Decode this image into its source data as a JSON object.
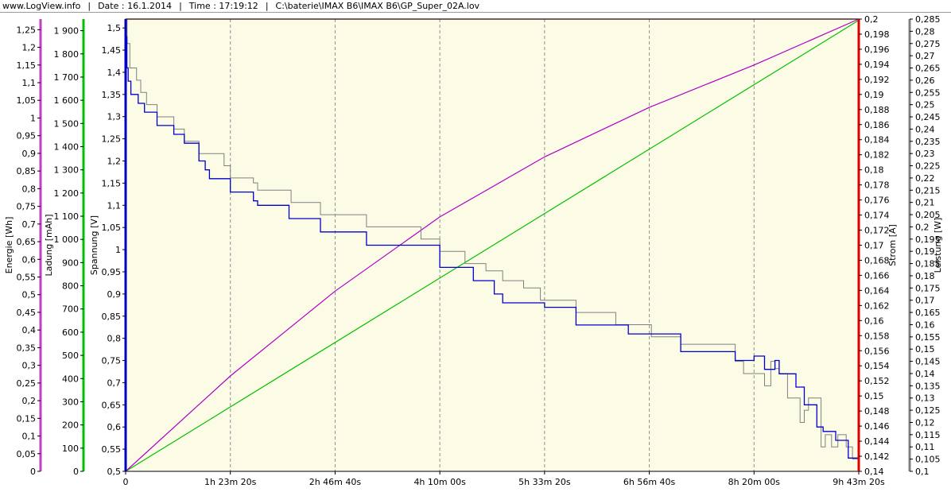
{
  "header": {
    "brand": "www.LogView.info",
    "date": "Date : 16.1.2014",
    "time": "Time : 17:19:12",
    "file": "C:\\baterie\\IMAX B6\\IMAX B6\\GP_Super_02A.lov"
  },
  "chart_data": {
    "type": "line",
    "background": "#fcfce6",
    "plot_border_color": "#000000",
    "vertical_grid": "dashed",
    "x": {
      "label": "",
      "range_s": [
        0,
        35000
      ],
      "ticks_s": [
        0,
        5000,
        10000,
        15000,
        20000,
        25000,
        30000,
        35000
      ],
      "tick_labels": [
        "0",
        "1h 23m 20s",
        "2h 46m 40s",
        "4h 10m 00s",
        "5h 33m 20s",
        "6h 56m 40s",
        "8h 20m 00s",
        "9h 43m 20s"
      ]
    },
    "axes": {
      "energie": {
        "label": "Energie [Wh]",
        "color": "#c040c0",
        "range": [
          0,
          1.28
        ],
        "ticks": [
          "0",
          "0,05",
          "0,1",
          "0,15",
          "0,2",
          "0,25",
          "0,3",
          "0,35",
          "0,4",
          "0,45",
          "0,5",
          "0,55",
          "0,6",
          "0,65",
          "0,7",
          "0,75",
          "0,8",
          "0,85",
          "0,9",
          "0,95",
          "1",
          "1,05",
          "1,1",
          "1,15",
          "1,2",
          "1,25"
        ]
      },
      "ladung": {
        "label": "Ladung [mAh]",
        "color": "#00c000",
        "range": [
          0,
          1950
        ],
        "ticks": [
          "0",
          "100",
          "200",
          "300",
          "400",
          "500",
          "600",
          "700",
          "800",
          "900",
          "1 000",
          "1 100",
          "1 200",
          "1 300",
          "1 400",
          "1 500",
          "1 600",
          "1 700",
          "1 800",
          "1 900"
        ]
      },
      "spannung": {
        "label": "Spannung [V]",
        "color": "#0000c0",
        "range": [
          0.5,
          1.52
        ],
        "ticks": [
          "0,5",
          "0,55",
          "0,6",
          "0,65",
          "0,7",
          "0,75",
          "0,8",
          "0,85",
          "0,9",
          "0,95",
          "1",
          "1,05",
          "1,1",
          "1,15",
          "1,2",
          "1,25",
          "1,3",
          "1,35",
          "1,4",
          "1,45",
          "1,5"
        ]
      },
      "strom": {
        "label": "Strom [A]",
        "color": "#e00000",
        "range": [
          0.14,
          0.2
        ],
        "ticks": [
          "0,14",
          "0,142",
          "0,144",
          "0,146",
          "0,148",
          "0,15",
          "0,152",
          "0,154",
          "0,156",
          "0,158",
          "0,16",
          "0,162",
          "0,164",
          "0,166",
          "0,168",
          "0,17",
          "0,172",
          "0,174",
          "0,176",
          "0,178",
          "0,18",
          "0,182",
          "0,184",
          "0,186",
          "0,188",
          "0,19",
          "0,192",
          "0,194",
          "0,196",
          "0,198",
          "0,2"
        ]
      },
      "leistung": {
        "label": "Leistung [W]",
        "color": "#808080",
        "range": [
          0.1,
          0.285
        ],
        "ticks": [
          "0,1",
          "0,105",
          "0,11",
          "0,115",
          "0,12",
          "0,125",
          "0,13",
          "0,135",
          "0,14",
          "0,145",
          "0,15",
          "0,155",
          "0,16",
          "0,165",
          "0,17",
          "0,175",
          "0,18",
          "0,185",
          "0,19",
          "0,195",
          "0,2",
          "0,205",
          "0,21",
          "0,215",
          "0,22",
          "0,225",
          "0,23",
          "0,235",
          "0,24",
          "0,245",
          "0,25",
          "0,255",
          "0,26",
          "0,265",
          "0,27",
          "0,275",
          "0,28",
          "0,285"
        ]
      }
    },
    "series": [
      {
        "axis": "strom",
        "color": "#e00000",
        "width": 1.2,
        "step": false,
        "points": [
          [
            0,
            0.2
          ],
          [
            35000,
            0.2
          ]
        ]
      },
      {
        "axis": "ladung",
        "color": "#00c000",
        "width": 1.2,
        "step": false,
        "points": [
          [
            0,
            0
          ],
          [
            35000,
            1945
          ]
        ]
      },
      {
        "axis": "energie",
        "color": "#b000c8",
        "width": 1.2,
        "step": false,
        "points": [
          [
            0,
            0
          ],
          [
            5000,
            0.27
          ],
          [
            10000,
            0.51
          ],
          [
            15000,
            0.72
          ],
          [
            20000,
            0.89
          ],
          [
            25000,
            1.03
          ],
          [
            30000,
            1.15
          ],
          [
            35000,
            1.28
          ]
        ]
      },
      {
        "axis": "leistung",
        "color": "#808080",
        "width": 1,
        "step": true,
        "points": [
          [
            0,
            0.285
          ],
          [
            70,
            0.275
          ],
          [
            200,
            0.265
          ],
          [
            520,
            0.26
          ],
          [
            720,
            0.255
          ],
          [
            1000,
            0.25
          ],
          [
            1500,
            0.245
          ],
          [
            2300,
            0.24
          ],
          [
            2800,
            0.235
          ],
          [
            3500,
            0.23
          ],
          [
            4700,
            0.225
          ],
          [
            5000,
            0.22
          ],
          [
            6100,
            0.218
          ],
          [
            6300,
            0.215
          ],
          [
            7900,
            0.21
          ],
          [
            9300,
            0.205
          ],
          [
            11500,
            0.2
          ],
          [
            14100,
            0.195
          ],
          [
            15000,
            0.19
          ],
          [
            16200,
            0.185
          ],
          [
            17200,
            0.182
          ],
          [
            18000,
            0.178
          ],
          [
            19000,
            0.175
          ],
          [
            19800,
            0.17
          ],
          [
            21500,
            0.165
          ],
          [
            23400,
            0.16
          ],
          [
            25100,
            0.155
          ],
          [
            26500,
            0.152
          ],
          [
            29100,
            0.145
          ],
          [
            29500,
            0.14
          ],
          [
            30500,
            0.135
          ],
          [
            30800,
            0.145
          ],
          [
            31000,
            0.142
          ],
          [
            31200,
            0.14
          ],
          [
            31600,
            0.13
          ],
          [
            32200,
            0.12
          ],
          [
            32400,
            0.125
          ],
          [
            32600,
            0.13
          ],
          [
            33200,
            0.11
          ],
          [
            33400,
            0.115
          ],
          [
            33700,
            0.11
          ],
          [
            34000,
            0.115
          ],
          [
            34400,
            0.11
          ],
          [
            34700,
            0.105
          ],
          [
            35000,
            0.105
          ]
        ]
      },
      {
        "axis": "spannung",
        "color": "#0000d0",
        "width": 1.3,
        "step": true,
        "points": [
          [
            0,
            1.48
          ],
          [
            60,
            1.41
          ],
          [
            120,
            1.38
          ],
          [
            250,
            1.35
          ],
          [
            600,
            1.33
          ],
          [
            900,
            1.31
          ],
          [
            1500,
            1.28
          ],
          [
            2300,
            1.26
          ],
          [
            2800,
            1.24
          ],
          [
            3500,
            1.2
          ],
          [
            3800,
            1.18
          ],
          [
            4000,
            1.16
          ],
          [
            5000,
            1.13
          ],
          [
            6100,
            1.11
          ],
          [
            6300,
            1.1
          ],
          [
            7800,
            1.07
          ],
          [
            9300,
            1.04
          ],
          [
            11500,
            1.01
          ],
          [
            15000,
            0.96
          ],
          [
            16600,
            0.93
          ],
          [
            17600,
            0.9
          ],
          [
            18000,
            0.88
          ],
          [
            20000,
            0.87
          ],
          [
            21500,
            0.83
          ],
          [
            24000,
            0.81
          ],
          [
            26500,
            0.77
          ],
          [
            29100,
            0.75
          ],
          [
            30000,
            0.76
          ],
          [
            30500,
            0.73
          ],
          [
            31000,
            0.75
          ],
          [
            31200,
            0.72
          ],
          [
            32000,
            0.69
          ],
          [
            32400,
            0.65
          ],
          [
            33000,
            0.6
          ],
          [
            33300,
            0.59
          ],
          [
            33900,
            0.57
          ],
          [
            34500,
            0.53
          ],
          [
            35000,
            0.52
          ]
        ]
      }
    ]
  }
}
